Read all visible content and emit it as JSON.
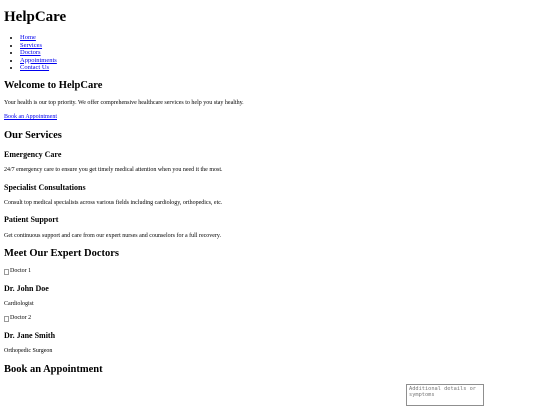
{
  "site": {
    "title": "HelpCare"
  },
  "nav": {
    "items": [
      {
        "label": "Home"
      },
      {
        "label": "Services"
      },
      {
        "label": "Doctors"
      },
      {
        "label": "Appointments"
      },
      {
        "label": "Contact Us"
      }
    ]
  },
  "hero": {
    "heading": "Welcome to HelpCare",
    "text": "Your health is our top priority. We offer comprehensive healthcare services to help you stay healthy.",
    "cta_label": "Book an Appointment"
  },
  "services": {
    "heading": "Our Services",
    "items": [
      {
        "title": "Emergency Care",
        "text": "24/7 emergency care to ensure you get timely medical attention when you need it the most."
      },
      {
        "title": "Specialist Consultations",
        "text": "Consult top medical specialists across various fields including cardiology, orthopedics, etc."
      },
      {
        "title": "Patient Support",
        "text": "Get continuous support and care from our expert nurses and counselors for a full recovery."
      }
    ]
  },
  "doctors": {
    "heading": "Meet Our Expert Doctors",
    "items": [
      {
        "image_alt": "Doctor 1",
        "name": "Dr. John Doe",
        "specialty": "Cardiologist"
      },
      {
        "image_alt": "Doctor 2",
        "name": "Dr. Jane Smith",
        "specialty": "Orthopedic Surgeon"
      }
    ]
  },
  "appointment": {
    "heading": "Book an Appointment",
    "details_placeholder": "Additional details or symptoms"
  }
}
